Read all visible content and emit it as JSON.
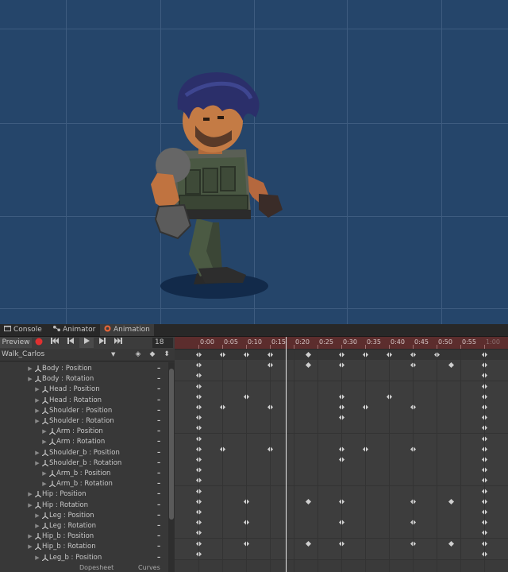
{
  "tabs": [
    {
      "label": "Console",
      "icon": "console-icon"
    },
    {
      "label": "Animator",
      "icon": "animator-icon"
    },
    {
      "label": "Animation",
      "icon": "animation-icon"
    }
  ],
  "toolbar": {
    "preview_label": "Preview",
    "frame_value": "18"
  },
  "clip": {
    "name": "Walk_Carlos"
  },
  "properties": [
    {
      "label": "Body : Position",
      "indent": 0
    },
    {
      "label": "Body : Rotation",
      "indent": 0
    },
    {
      "label": "Head : Position",
      "indent": 1
    },
    {
      "label": "Head : Rotation",
      "indent": 1
    },
    {
      "label": "Shoulder : Position",
      "indent": 1
    },
    {
      "label": "Shoulder : Rotation",
      "indent": 1
    },
    {
      "label": "Arm : Position",
      "indent": 2
    },
    {
      "label": "Arm : Rotation",
      "indent": 2
    },
    {
      "label": "Shoulder_b : Position",
      "indent": 1
    },
    {
      "label": "Shoulder_b : Rotation",
      "indent": 1
    },
    {
      "label": "Arm_b : Position",
      "indent": 2
    },
    {
      "label": "Arm_b : Rotation",
      "indent": 2
    },
    {
      "label": "Hip : Position",
      "indent": 0
    },
    {
      "label": "Hip : Rotation",
      "indent": 0
    },
    {
      "label": "Leg : Position",
      "indent": 1
    },
    {
      "label": "Leg : Rotation",
      "indent": 1
    },
    {
      "label": "Hip_b : Position",
      "indent": 0
    },
    {
      "label": "Hip_b : Rotation",
      "indent": 0
    },
    {
      "label": "Leg_b : Position",
      "indent": 1
    }
  ],
  "ruler_ticks": [
    "0:00",
    "0:05",
    "0:10",
    "0:15",
    "0:20",
    "0:25",
    "0:30",
    "0:35",
    "0:40",
    "0:45",
    "0:50",
    "0:55",
    "1:00"
  ],
  "playhead_frame": 18,
  "keyframes": {
    "summary": [
      0,
      5,
      10,
      15,
      23,
      30,
      35,
      40,
      45,
      50,
      60
    ],
    "rows": [
      [
        0,
        15,
        23,
        30,
        45,
        53,
        60
      ],
      [
        0,
        60
      ],
      [
        0,
        60
      ],
      [
        0,
        10,
        30,
        40,
        60
      ],
      [
        0,
        5,
        15,
        30,
        35,
        45,
        60
      ],
      [
        0,
        30,
        60
      ],
      [
        0,
        60
      ],
      [
        0,
        60
      ],
      [
        0,
        5,
        15,
        30,
        35,
        45,
        60
      ],
      [
        0,
        30,
        60
      ],
      [
        0,
        60
      ],
      [
        0,
        60
      ],
      [
        0,
        60
      ],
      [
        0,
        10,
        23,
        30,
        45,
        53,
        60
      ],
      [
        0,
        60
      ],
      [
        0,
        10,
        30,
        45,
        60
      ],
      [
        0,
        60
      ],
      [
        0,
        10,
        23,
        30,
        45,
        53,
        60
      ],
      [
        0,
        60
      ]
    ]
  },
  "bottom_tabs": [
    "Dopesheet",
    "Curves"
  ],
  "colors": {
    "scene_bg": "#25456a",
    "ruler_bg": "#5c2d2d",
    "record": "#e03030"
  }
}
